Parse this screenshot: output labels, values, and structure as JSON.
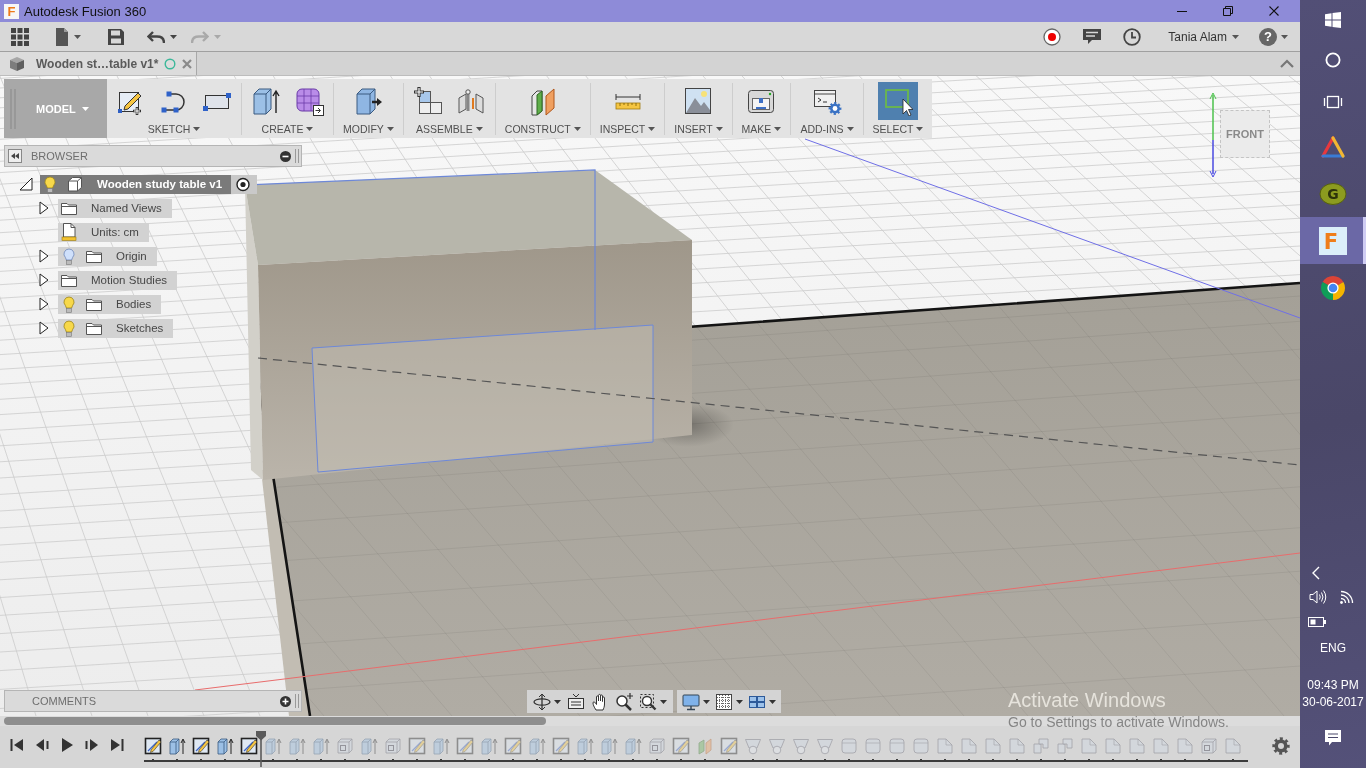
{
  "window": {
    "icon_letter": "F",
    "title": "Autodesk Fusion 360"
  },
  "quick_access": {
    "undo": {
      "disabled": false
    },
    "redo": {
      "disabled": true
    },
    "user": "Tania Alam",
    "help_glyph": "?"
  },
  "document_tab": {
    "label": "Wooden st…table v1*",
    "selected": true
  },
  "toolbar": {
    "workspace": "MODEL",
    "groups": [
      {
        "label": "SKETCH",
        "selected": false
      },
      {
        "label": "CREATE",
        "selected": false
      },
      {
        "label": "MODIFY",
        "selected": false
      },
      {
        "label": "ASSEMBLE",
        "selected": false
      },
      {
        "label": "CONSTRUCT",
        "selected": false
      },
      {
        "label": "INSPECT",
        "selected": false
      },
      {
        "label": "INSERT",
        "selected": false
      },
      {
        "label": "MAKE",
        "selected": false
      },
      {
        "label": "ADD-INS",
        "selected": false
      },
      {
        "label": "SELECT",
        "selected": true
      }
    ]
  },
  "browser": {
    "title": "BROWSER",
    "root": {
      "label": "Wooden study table v1",
      "expanded": true,
      "visible": true,
      "active": true,
      "children": [
        {
          "kind": "folder",
          "label": "Named Views",
          "expanded": false
        },
        {
          "kind": "units",
          "label": "Units: cm"
        },
        {
          "kind": "light_folder",
          "label": "Origin",
          "expanded": false,
          "visible": false
        },
        {
          "kind": "folder",
          "label": "Motion Studies",
          "expanded": false
        },
        {
          "kind": "light_folder",
          "label": "Bodies",
          "expanded": false,
          "visible": true
        },
        {
          "kind": "light_folder",
          "label": "Sketches",
          "expanded": false,
          "visible": true
        }
      ]
    }
  },
  "view_cube": {
    "face": "FRONT"
  },
  "comments": {
    "title": "COMMENTS"
  },
  "timeline": {
    "items": [
      {
        "kind": "sketch",
        "rolled_back": false
      },
      {
        "kind": "extrude",
        "rolled_back": false
      },
      {
        "kind": "sketch",
        "rolled_back": false
      },
      {
        "kind": "extrude",
        "rolled_back": false
      },
      {
        "kind": "sketch",
        "rolled_back": false
      },
      {
        "kind": "extrude",
        "rolled_back": true
      },
      {
        "kind": "extrude",
        "rolled_back": true
      },
      {
        "kind": "extrude",
        "rolled_back": true
      },
      {
        "kind": "shell",
        "rolled_back": true
      },
      {
        "kind": "extrude",
        "rolled_back": true
      },
      {
        "kind": "shell",
        "rolled_back": true
      },
      {
        "kind": "sketch",
        "rolled_back": true
      },
      {
        "kind": "extrude",
        "rolled_back": true
      },
      {
        "kind": "sketch",
        "rolled_back": true
      },
      {
        "kind": "extrude",
        "rolled_back": true
      },
      {
        "kind": "sketch",
        "rolled_back": true
      },
      {
        "kind": "extrude",
        "rolled_back": true
      },
      {
        "kind": "sketch",
        "rolled_back": true
      },
      {
        "kind": "extrude",
        "rolled_back": true
      },
      {
        "kind": "extrude",
        "rolled_back": true
      },
      {
        "kind": "extrude",
        "rolled_back": true
      },
      {
        "kind": "shell",
        "rolled_back": true
      },
      {
        "kind": "sketch",
        "rolled_back": true
      },
      {
        "kind": "plane",
        "rolled_back": true
      },
      {
        "kind": "sketch",
        "rolled_back": true
      },
      {
        "kind": "fillet",
        "rolled_back": true
      },
      {
        "kind": "fillet",
        "rolled_back": true
      },
      {
        "kind": "fillet",
        "rolled_back": true
      },
      {
        "kind": "fillet",
        "rolled_back": true
      },
      {
        "kind": "cylinder",
        "rolled_back": true
      },
      {
        "kind": "cylinder",
        "rolled_back": true
      },
      {
        "kind": "cylinder",
        "rolled_back": true
      },
      {
        "kind": "cylinder",
        "rolled_back": true
      },
      {
        "kind": "chamfer",
        "rolled_back": true
      },
      {
        "kind": "chamfer",
        "rolled_back": true
      },
      {
        "kind": "chamfer",
        "rolled_back": true
      },
      {
        "kind": "chamfer",
        "rolled_back": true
      },
      {
        "kind": "combine",
        "rolled_back": true
      },
      {
        "kind": "combine",
        "rolled_back": true
      },
      {
        "kind": "chamfer",
        "rolled_back": true
      },
      {
        "kind": "chamfer",
        "rolled_back": true
      },
      {
        "kind": "chamfer",
        "rolled_back": true
      },
      {
        "kind": "chamfer",
        "rolled_back": true
      },
      {
        "kind": "chamfer",
        "rolled_back": true
      },
      {
        "kind": "shell",
        "rolled_back": true
      },
      {
        "kind": "chamfer",
        "rolled_back": true
      }
    ]
  },
  "activation_notice": {
    "heading": "Activate Windows",
    "message": "Go to Settings to activate Windows."
  },
  "taskbar": {
    "apps": [
      {
        "kind": "triangle",
        "selected": false
      },
      {
        "kind": "badge",
        "glyph": "G",
        "selected": false
      },
      {
        "kind": "fusion",
        "glyph": "F",
        "selected": true
      },
      {
        "kind": "chrome",
        "selected": false
      }
    ],
    "language": "ENG",
    "time": "09:43 PM",
    "date": "30-06-2017"
  }
}
